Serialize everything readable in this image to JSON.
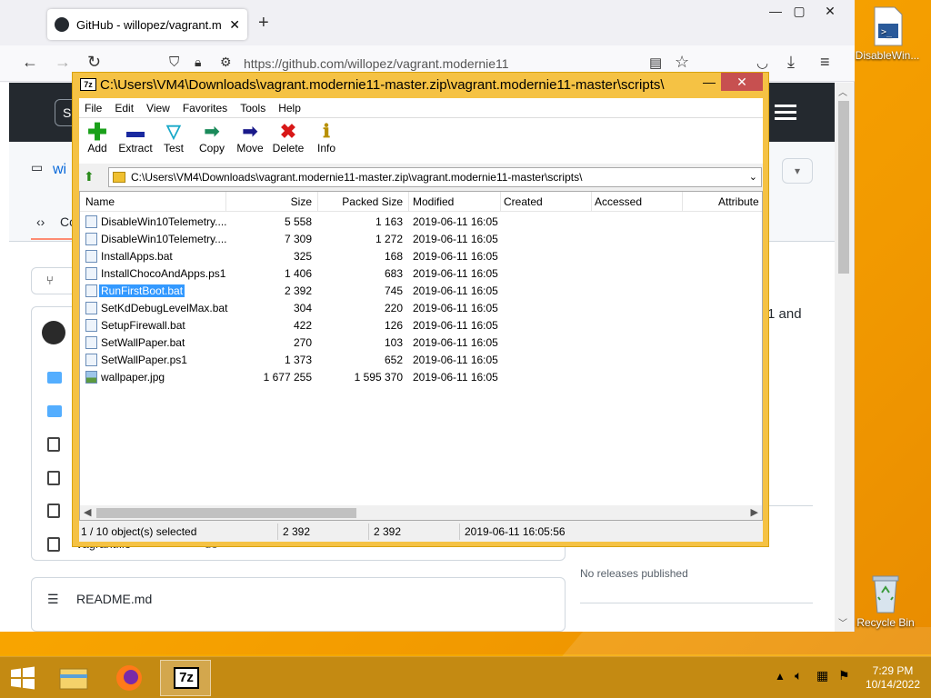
{
  "browser": {
    "tab_title": "GitHub - willopez/vagrant.mod",
    "url": "https://github.com/willopez/vagrant.modernie11",
    "page": {
      "signin_label": "Sig",
      "repo_fragment": "wi",
      "code_tab_fragment": "Co",
      "right_text_fragment": "1 and",
      "readme_label": "README.md",
      "no_releases": "No releases published",
      "partial_row": "vagrantfile",
      "partial_row_2": "de"
    }
  },
  "sevenzip": {
    "title": "C:\\Users\\VM4\\Downloads\\vagrant.modernie11-master.zip\\vagrant.modernie11-master\\scripts\\",
    "menu": [
      "File",
      "Edit",
      "View",
      "Favorites",
      "Tools",
      "Help"
    ],
    "toolbar": {
      "add": "Add",
      "extract": "Extract",
      "test": "Test",
      "copy": "Copy",
      "move": "Move",
      "delete": "Delete",
      "info": "Info"
    },
    "address": "C:\\Users\\VM4\\Downloads\\vagrant.modernie11-master.zip\\vagrant.modernie11-master\\scripts\\",
    "columns": {
      "name": "Name",
      "size": "Size",
      "packed": "Packed Size",
      "modified": "Modified",
      "created": "Created",
      "accessed": "Accessed",
      "attributes": "Attribute"
    },
    "files": [
      {
        "name": "DisableWin10Telemetry....",
        "size": "5 558",
        "packed": "1 163",
        "modified": "2019-06-11 16:05"
      },
      {
        "name": "DisableWin10Telemetry....",
        "size": "7 309",
        "packed": "1 272",
        "modified": "2019-06-11 16:05"
      },
      {
        "name": "InstallApps.bat",
        "size": "325",
        "packed": "168",
        "modified": "2019-06-11 16:05"
      },
      {
        "name": "InstallChocoAndApps.ps1",
        "size": "1 406",
        "packed": "683",
        "modified": "2019-06-11 16:05"
      },
      {
        "name": "RunFirstBoot.bat",
        "size": "2 392",
        "packed": "745",
        "modified": "2019-06-11 16:05"
      },
      {
        "name": "SetKdDebugLevelMax.bat",
        "size": "304",
        "packed": "220",
        "modified": "2019-06-11 16:05"
      },
      {
        "name": "SetupFirewall.bat",
        "size": "422",
        "packed": "126",
        "modified": "2019-06-11 16:05"
      },
      {
        "name": "SetWallPaper.bat",
        "size": "270",
        "packed": "103",
        "modified": "2019-06-11 16:05"
      },
      {
        "name": "SetWallPaper.ps1",
        "size": "1 373",
        "packed": "652",
        "modified": "2019-06-11 16:05"
      },
      {
        "name": "wallpaper.jpg",
        "size": "1 677 255",
        "packed": "1 595 370",
        "modified": "2019-06-11 16:05"
      }
    ],
    "status": {
      "selected": "1 / 10 object(s) selected",
      "size": "2 392",
      "packed": "2 392",
      "modified": "2019-06-11 16:05:56"
    }
  },
  "desktop": {
    "icon1_label": "DisableWin...",
    "icon2_label": "Recycle Bin"
  },
  "taskbar": {
    "time": "7:29 PM",
    "date": "10/14/2022",
    "sevenzip_label": "7z"
  }
}
